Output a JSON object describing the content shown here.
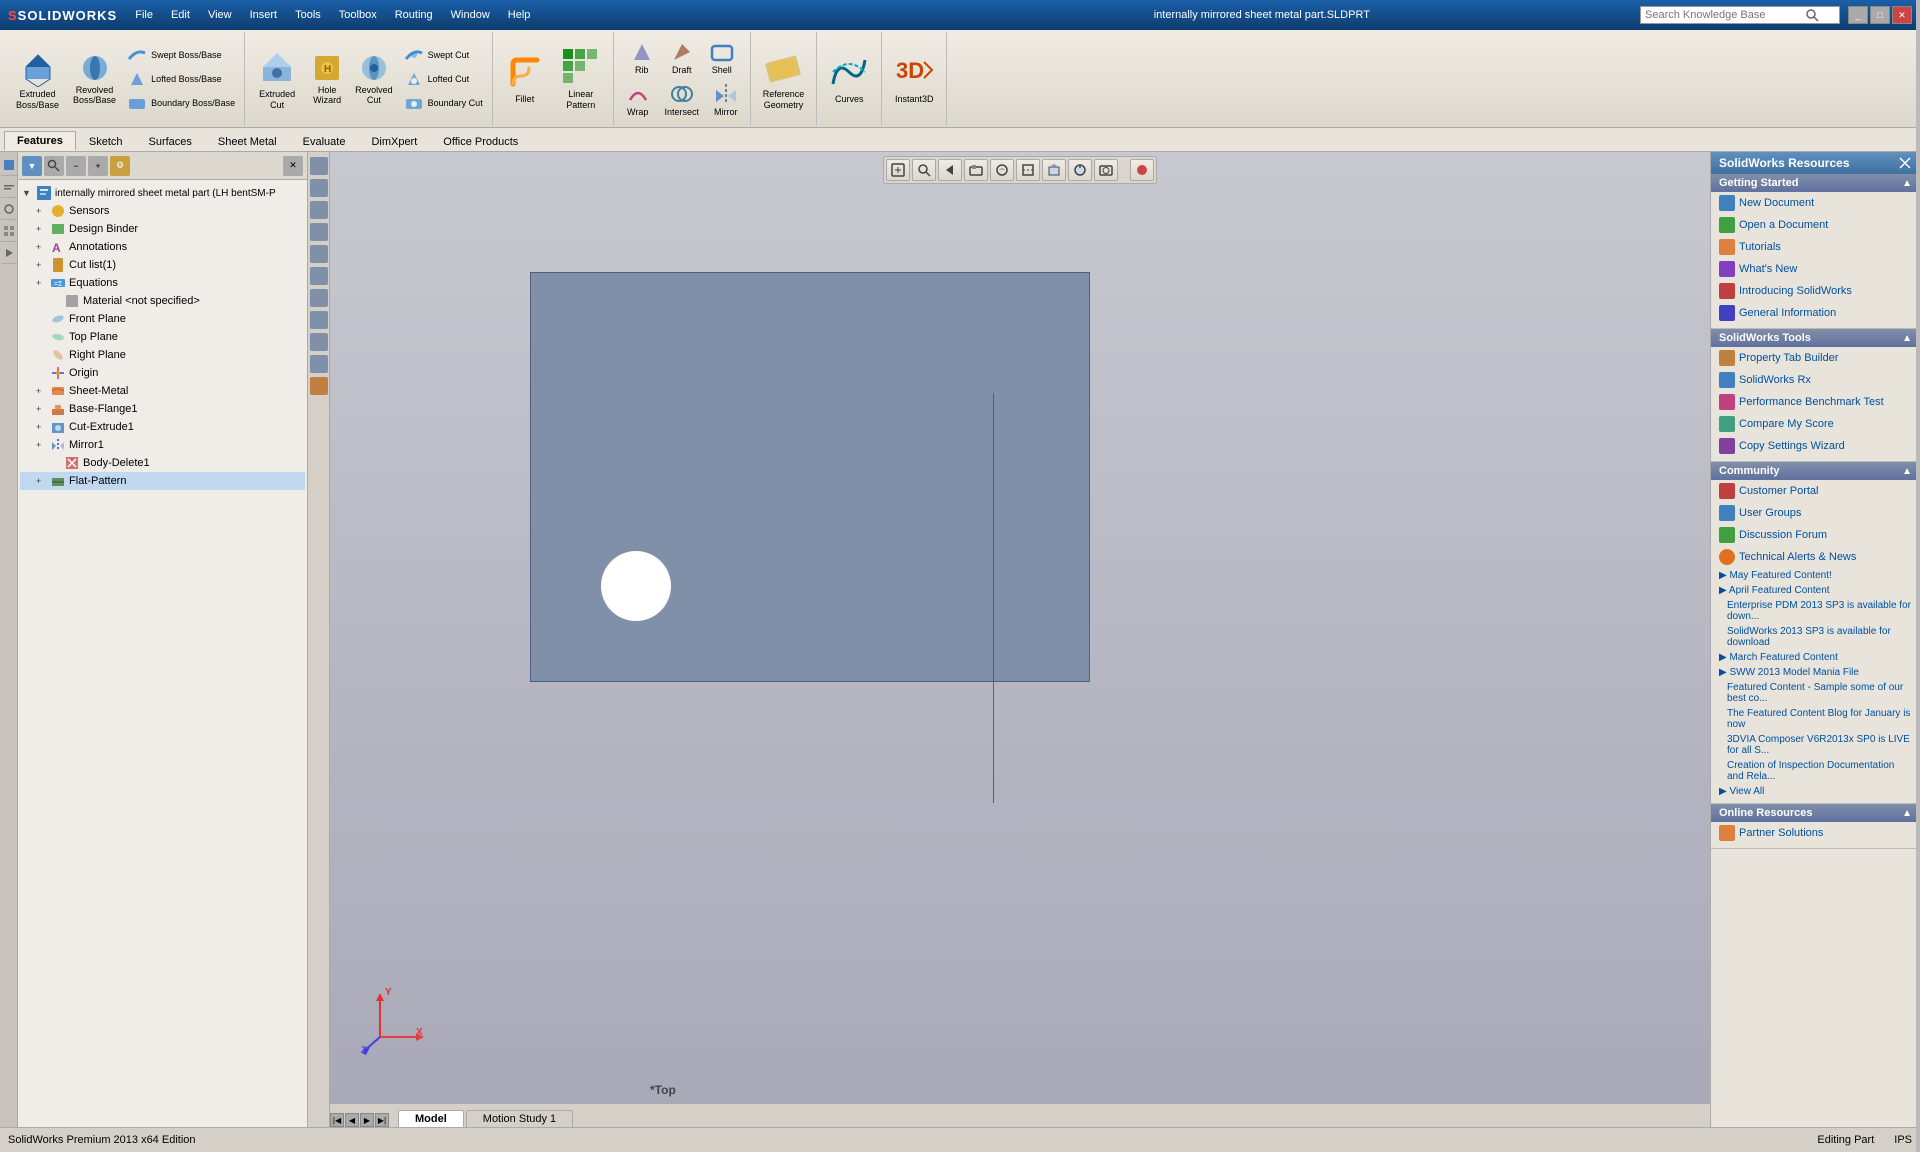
{
  "app": {
    "name": "SOLIDWORKS",
    "title_file": "internally mirrored sheet metal part.SLDPRT",
    "logo": "SOLIDWORKS"
  },
  "menu": {
    "items": [
      "File",
      "Edit",
      "View",
      "Insert",
      "Tools",
      "Toolbox",
      "Routing",
      "Window",
      "Help"
    ]
  },
  "search": {
    "placeholder": "Search Knowledge Base"
  },
  "toolbar": {
    "sections": {
      "boss_features": {
        "large_btn": {
          "label": "Extruded\nBoss/Base",
          "icon": "extrude-icon"
        },
        "medium_btn": {
          "label": "Revolved\nBoss/Base",
          "icon": "revolve-icon"
        },
        "small_btns": [
          {
            "label": "Swept Boss/Base",
            "icon": "swept-icon"
          },
          {
            "label": "Lofted Boss/Base",
            "icon": "lofted-icon"
          },
          {
            "label": "Boundary Boss/Base",
            "icon": "boundary-icon"
          }
        ]
      },
      "cut_features": {
        "large_btn": {
          "label": "Extruded\nCut",
          "icon": "extrude-cut-icon"
        },
        "medium_btn": {
          "label": "Hole\nWizard",
          "icon": "hole-icon"
        },
        "medium_btn2": {
          "label": "Revolved\nCut",
          "icon": "revolve-cut-icon"
        },
        "small_btns": [
          {
            "label": "Swept Cut",
            "icon": "swept-cut-icon"
          },
          {
            "label": "Lofted Cut",
            "icon": "lofted-cut-icon"
          },
          {
            "label": "Boundary Cut",
            "icon": "boundary-cut-icon"
          }
        ]
      },
      "modify": {
        "btns": [
          {
            "label": "Fillet",
            "icon": "fillet-icon"
          },
          {
            "label": "Linear\nPattern",
            "icon": "linear-icon"
          },
          {
            "label": "Rib",
            "icon": "rib-icon"
          },
          {
            "label": "Draft",
            "icon": "draft-icon"
          },
          {
            "label": "Shell",
            "icon": "shell-icon"
          },
          {
            "label": "Wrap",
            "icon": "wrap-icon"
          },
          {
            "label": "Intersect",
            "icon": "intersect-icon"
          },
          {
            "label": "Mirror",
            "icon": "mirror-icon"
          }
        ]
      },
      "geometry": {
        "btns": [
          {
            "label": "Reference\nGeometry",
            "icon": "ref-geom-icon"
          },
          {
            "label": "Curves",
            "icon": "curves-icon"
          },
          {
            "label": "Instant3D",
            "icon": "instant3d-icon"
          }
        ]
      }
    }
  },
  "ribbon_tabs": {
    "items": [
      "Features",
      "Sketch",
      "Surfaces",
      "Sheet Metal",
      "Evaluate",
      "DimXpert",
      "Office Products"
    ],
    "active": "Features"
  },
  "feature_tree": {
    "title": "internally mirrored sheet metal part  (LH bentSM-P",
    "items": [
      {
        "label": "Sensors",
        "indent": 1,
        "expand": "+"
      },
      {
        "label": "Design Binder",
        "indent": 1,
        "expand": "+"
      },
      {
        "label": "Annotations",
        "indent": 1,
        "expand": "+"
      },
      {
        "label": "Cut list(1)",
        "indent": 1,
        "expand": "+"
      },
      {
        "label": "Equations",
        "indent": 1,
        "expand": "+"
      },
      {
        "label": "Material <not specified>",
        "indent": 2
      },
      {
        "label": "Front Plane",
        "indent": 1
      },
      {
        "label": "Top Plane",
        "indent": 1
      },
      {
        "label": "Right Plane",
        "indent": 1
      },
      {
        "label": "Origin",
        "indent": 1
      },
      {
        "label": "Sheet-Metal",
        "indent": 1,
        "expand": "+"
      },
      {
        "label": "Base-Flange1",
        "indent": 1,
        "expand": "+"
      },
      {
        "label": "Cut-Extrude1",
        "indent": 1,
        "expand": "+"
      },
      {
        "label": "Mirror1",
        "indent": 1,
        "expand": "+"
      },
      {
        "label": "Body-Delete1",
        "indent": 2
      },
      {
        "label": "Flat-Pattern",
        "indent": 1,
        "expand": "+"
      }
    ]
  },
  "viewport": {
    "label": "*Top"
  },
  "bottom_tabs": {
    "items": [
      "Model",
      "Motion Study 1"
    ],
    "active": "Model"
  },
  "right_panel": {
    "title": "SolidWorks Resources",
    "sections": {
      "getting_started": {
        "label": "Getting Started",
        "links": [
          {
            "label": "New Document"
          },
          {
            "label": "Open a Document"
          },
          {
            "label": "Tutorials"
          },
          {
            "label": "What's New"
          },
          {
            "label": "Introducing SolidWorks"
          },
          {
            "label": "General Information"
          }
        ]
      },
      "solidworks_tools": {
        "label": "SolidWorks Tools",
        "links": [
          {
            "label": "Property Tab Builder"
          },
          {
            "label": "SolidWorks Rx"
          },
          {
            "label": "Performance Benchmark Test"
          },
          {
            "label": "Compare My Score"
          },
          {
            "label": "Copy Settings Wizard"
          }
        ]
      },
      "community": {
        "label": "Community",
        "links": [
          {
            "label": "Customer Portal"
          },
          {
            "label": "User Groups"
          },
          {
            "label": "Discussion Forum"
          },
          {
            "label": "Technical Alerts & News"
          }
        ]
      },
      "news_items": [
        {
          "label": "▶ May Featured Content!"
        },
        {
          "label": "▶ April Featured Content"
        },
        {
          "label": "Enterprise PDM 2013 SP3 is available for down...",
          "indent": true
        },
        {
          "label": "SolidWorks 2013 SP3 is available for download",
          "indent": true
        },
        {
          "label": "▶ March Featured Content"
        },
        {
          "label": "▶ SWW 2013 Model Mania File"
        },
        {
          "label": "Featured Content - Sample some of our best co...",
          "indent": true
        },
        {
          "label": "The Featured Content Blog for January is now",
          "indent": true
        },
        {
          "label": "3DVIA Composer V6R2013x SP0 is LIVE for all S...",
          "indent": true
        },
        {
          "label": "Creation of Inspection Documentation and Rela...",
          "indent": true
        },
        {
          "label": "▶ View All"
        }
      ],
      "online_resources": {
        "label": "Online Resources",
        "links": [
          {
            "label": "Partner Solutions"
          }
        ]
      }
    }
  },
  "status_bar": {
    "app_label": "SolidWorks Premium 2013 x64 Edition",
    "status": "Editing Part",
    "units": "IPS"
  }
}
